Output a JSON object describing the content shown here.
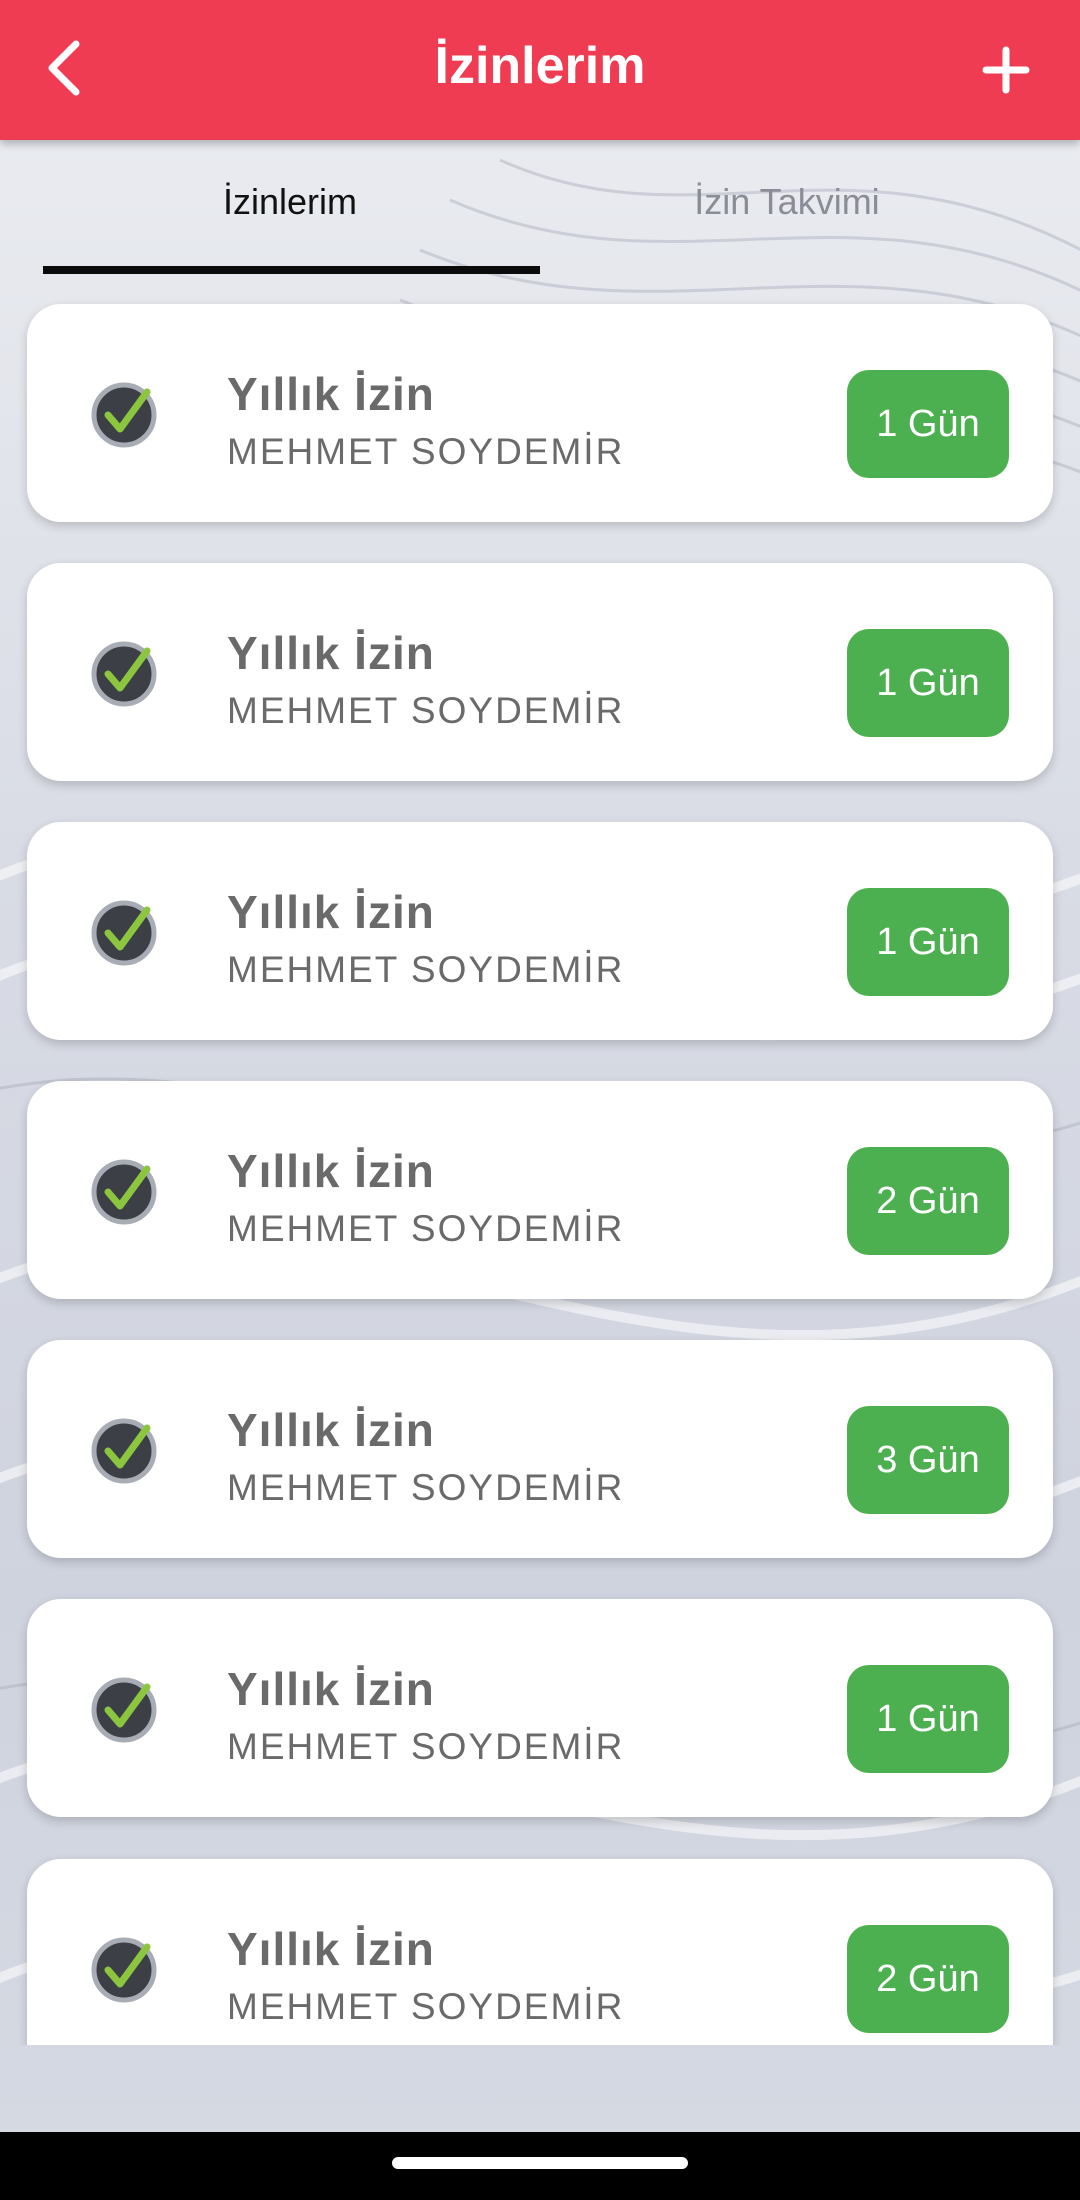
{
  "header": {
    "title": "İzinlerim"
  },
  "tabs": [
    {
      "label": "İzinlerim",
      "active": true
    },
    {
      "label": "İzin Takvimi",
      "active": false
    }
  ],
  "leaves": [
    {
      "type": "Yıllık İzin",
      "employee": "MEHMET SOYDEMİR",
      "days": "1 Gün"
    },
    {
      "type": "Yıllık İzin",
      "employee": "MEHMET SOYDEMİR",
      "days": "1 Gün"
    },
    {
      "type": "Yıllık İzin",
      "employee": "MEHMET SOYDEMİR",
      "days": "1 Gün"
    },
    {
      "type": "Yıllık İzin",
      "employee": "MEHMET SOYDEMİR",
      "days": "2 Gün"
    },
    {
      "type": "Yıllık İzin",
      "employee": "MEHMET SOYDEMİR",
      "days": "3 Gün"
    },
    {
      "type": "Yıllık İzin",
      "employee": "MEHMET SOYDEMİR",
      "days": "1 Gün"
    },
    {
      "type": "Yıllık İzin",
      "employee": "MEHMET SOYDEMİR",
      "days": "2 Gün"
    }
  ],
  "icons": {
    "back": "back-arrow-icon",
    "add": "plus-icon",
    "status": "approved-check-icon"
  },
  "colors": {
    "appbar": "#f03c53",
    "badge": "#4caf50",
    "check": "#8cc63f",
    "text": "#6a6a6a"
  }
}
